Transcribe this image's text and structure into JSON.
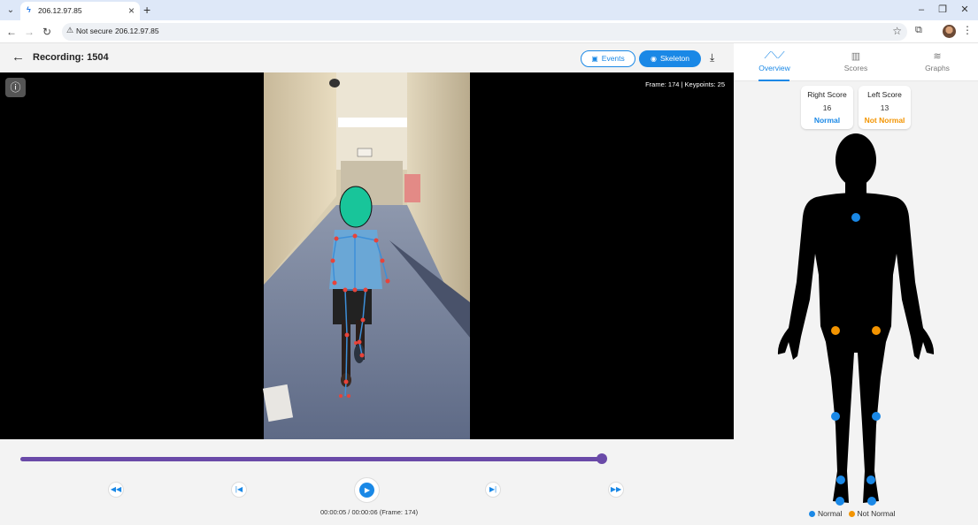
{
  "browser": {
    "tab_title": "206.12.97.85",
    "security_label": "Not secure",
    "url": "206.12.97.85"
  },
  "header": {
    "title": "Recording: 1504",
    "events_label": "Events",
    "skeleton_label": "Skeleton"
  },
  "video": {
    "frame_info": "Frame: 174 | Keypoints: 25"
  },
  "playback": {
    "progress": 0.995,
    "time_readout": "00:00:05 / 00:00:06 (Frame: 174)"
  },
  "side_tabs": [
    {
      "label": "Overview",
      "icon": "trending-up-icon",
      "active": true
    },
    {
      "label": "Scores",
      "icon": "bar-chart-icon",
      "active": false
    },
    {
      "label": "Graphs",
      "icon": "multiline-chart-icon",
      "active": false
    }
  ],
  "scores": {
    "right": {
      "title": "Right Score",
      "value": "16",
      "status": "Normal",
      "status_color": "#1a88e6"
    },
    "left": {
      "title": "Left Score",
      "value": "13",
      "status": "Not Normal",
      "status_color": "#f39400"
    }
  },
  "joints": [
    {
      "name": "spine",
      "status": "normal"
    },
    {
      "name": "hip-right",
      "status": "not-normal"
    },
    {
      "name": "hip-left",
      "status": "not-normal"
    },
    {
      "name": "knee-right",
      "status": "normal"
    },
    {
      "name": "knee-left",
      "status": "normal"
    },
    {
      "name": "ankle-right",
      "status": "normal"
    },
    {
      "name": "ankle-left",
      "status": "normal"
    },
    {
      "name": "foot-right",
      "status": "normal"
    },
    {
      "name": "foot-left",
      "status": "normal"
    }
  ],
  "legend": {
    "normal": "Normal",
    "not_normal": "Not Normal"
  },
  "colors": {
    "normal": "#1a88e6",
    "not_normal": "#f39400",
    "accent": "#1a88e6",
    "timeline": "#6a4aa8"
  }
}
